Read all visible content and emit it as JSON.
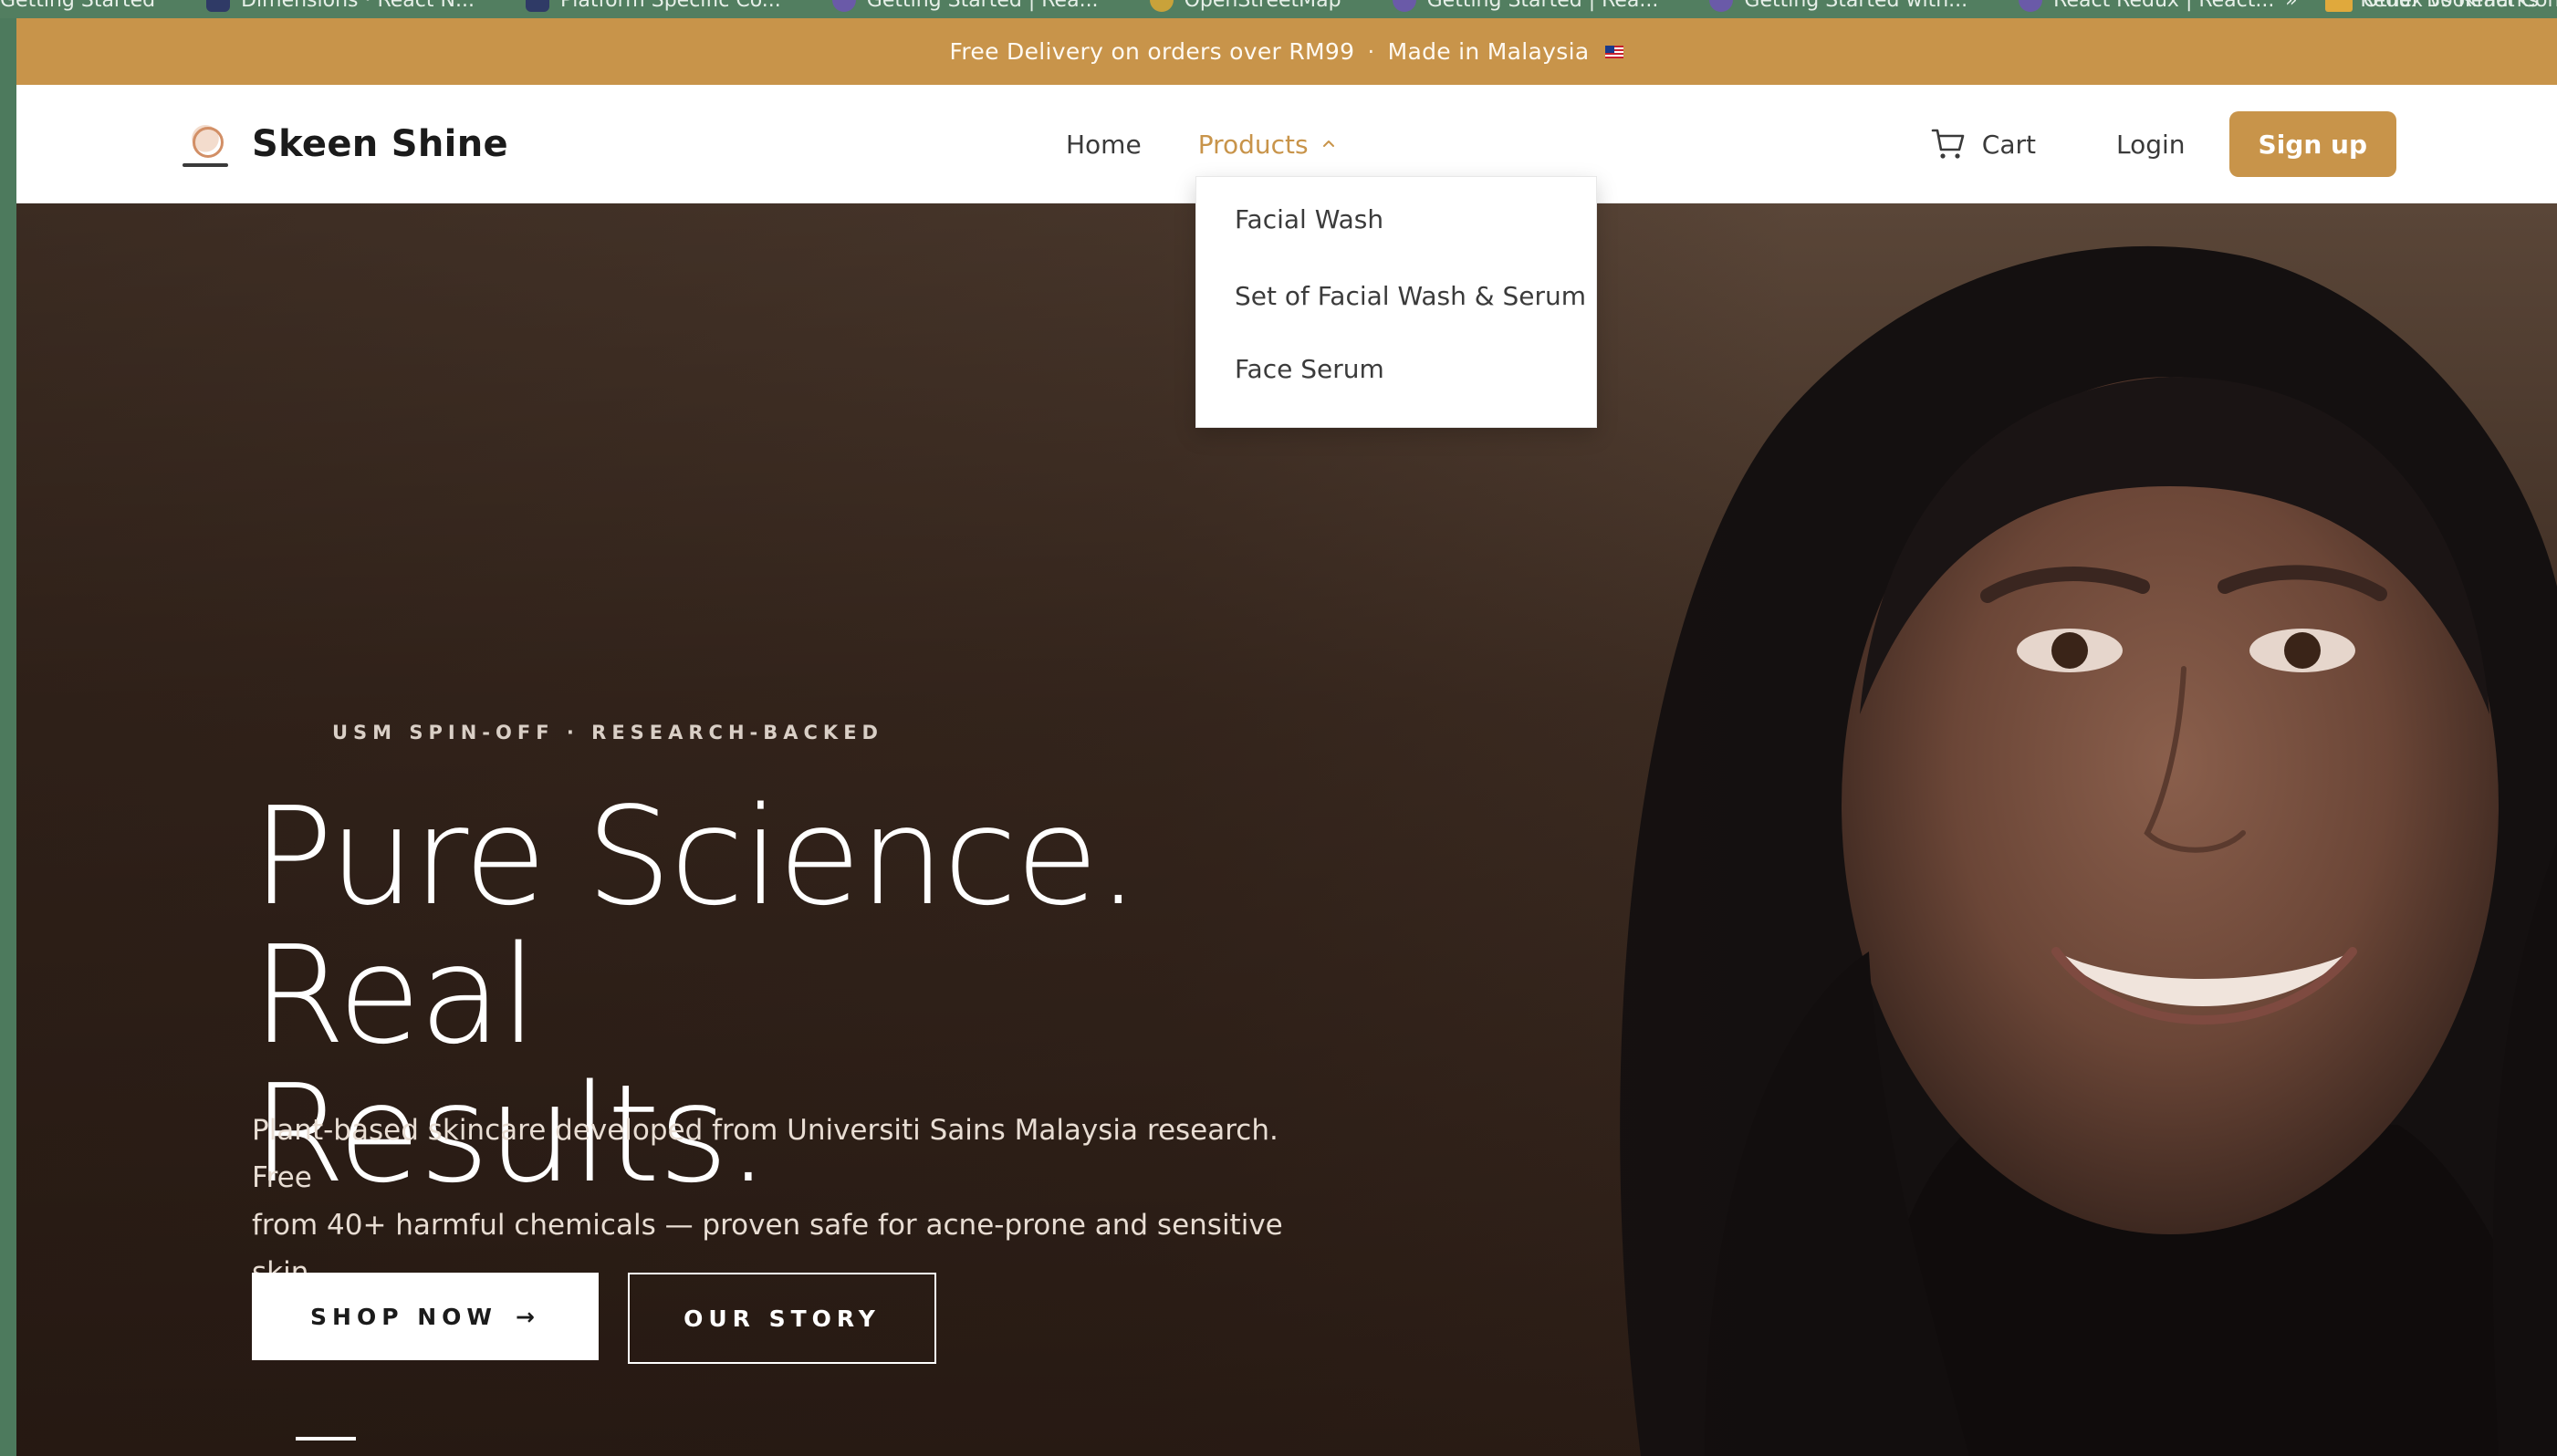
{
  "bookmarks": {
    "items": [
      {
        "label": "Getting Started"
      },
      {
        "label": "Dimensions · React N..."
      },
      {
        "label": "Platform Specific Co..."
      },
      {
        "label": "Getting Started | Rea..."
      },
      {
        "label": "OpenStreetMap"
      },
      {
        "label": "Getting Started | Rea..."
      },
      {
        "label": "Getting Started with..."
      },
      {
        "label": "React Redux | React..."
      },
      {
        "label": "Redux vs React Con..."
      }
    ],
    "more": "»",
    "other_bookmarks": "Other Bookmarks"
  },
  "announcement": {
    "text": "Free Delivery on orders over RM99",
    "separator": "·",
    "made_in": "Made in Malaysia"
  },
  "brand": {
    "name": "Skeen Shine",
    "logo_icon": "skeen-shine-logo"
  },
  "nav": {
    "home": "Home",
    "products": "Products",
    "cart": "Cart",
    "login": "Login",
    "signup": "Sign up"
  },
  "products_menu": [
    {
      "label": "Facial Wash"
    },
    {
      "label": "Set of Facial Wash & Serum"
    },
    {
      "label": "Face Serum"
    }
  ],
  "hero": {
    "eyebrow": "USM SPIN-OFF · RESEARCH-BACKED",
    "headline_line1": "Pure Science. Real",
    "headline_line2": "Results.",
    "subtext_line1": "Plant-based skincare developed from Universiti Sains Malaysia research. Free",
    "subtext_line2": "from 40+ harmful chemicals — proven safe for acne-prone and sensitive skin.",
    "shop_now": "SHOP NOW",
    "shop_arrow": "→",
    "our_story": "OUR STORY"
  },
  "colors": {
    "accent": "#c8944a",
    "hero_dark": "#2b1d16",
    "nav_bg": "#ffffff",
    "browser_bg": "#4d7a5d"
  }
}
